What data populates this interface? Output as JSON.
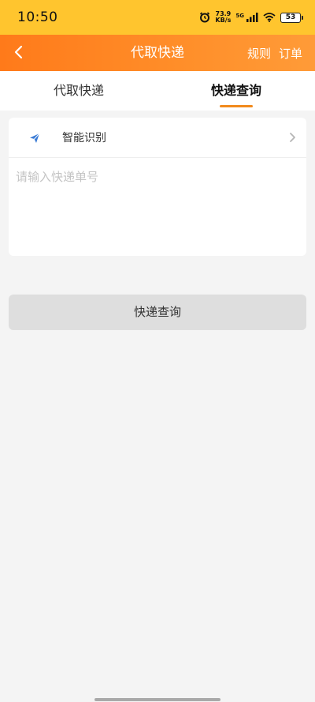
{
  "status_bar": {
    "time": "10:50",
    "net_speed_value": "73.9",
    "net_speed_unit": "KB/s",
    "network_type": "5G",
    "battery": "53",
    "icons": [
      "alarm-icon",
      "signal-icon",
      "wifi-icon",
      "battery-icon"
    ]
  },
  "nav": {
    "title": "代取快递",
    "rules_label": "规则",
    "orders_label": "订单"
  },
  "tabs": [
    {
      "label": "代取快递",
      "active": false
    },
    {
      "label": "快递查询",
      "active": true
    }
  ],
  "smart_recognition": {
    "label": "智能识别",
    "icon": "paper-plane-icon"
  },
  "tracking_input": {
    "placeholder": "请输入快递单号",
    "value": ""
  },
  "query_button": {
    "label": "快递查询"
  },
  "colors": {
    "status_bar": "#ffc52e",
    "nav_gradient_start": "#ff7a1a",
    "nav_gradient_end": "#ff9b38",
    "tab_underline": "#f28a1c",
    "icon_blue": "#3a7bd5",
    "button_bg": "#dedede",
    "page_bg": "#f4f4f4"
  }
}
